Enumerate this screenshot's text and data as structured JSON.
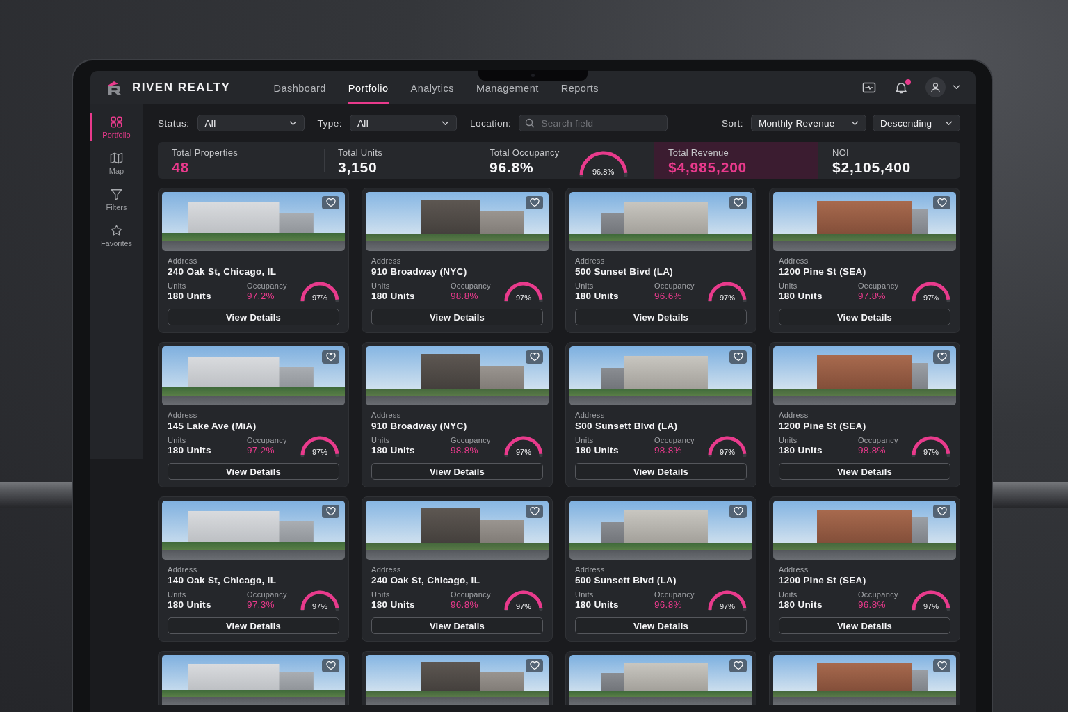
{
  "brand": {
    "name": "RIVEN REALTY"
  },
  "nav": [
    {
      "label": "Dashboard",
      "selected": false
    },
    {
      "label": "Portfolio",
      "selected": true
    },
    {
      "label": "Analytics",
      "selected": false
    },
    {
      "label": "Management",
      "selected": false
    },
    {
      "label": "Reports",
      "selected": false
    }
  ],
  "header_actions": {
    "notifications_unread": true
  },
  "sidebar": [
    {
      "kind": "grid",
      "label": "Portfolio",
      "selected": true
    },
    {
      "kind": "map",
      "label": "Map",
      "selected": false
    },
    {
      "kind": "filter",
      "label": "Filters",
      "selected": false
    },
    {
      "kind": "star",
      "label": "Favorites",
      "selected": false
    }
  ],
  "filters": [
    {
      "kind": "select",
      "label": "Status:",
      "value": "All"
    },
    {
      "kind": "select",
      "label": "Type:",
      "value": "All"
    },
    {
      "kind": "search",
      "label": "Location:",
      "placeholder": "Search field"
    }
  ],
  "sort": {
    "label": "Sort:",
    "field": "Monthly Revenue",
    "order": "Descending"
  },
  "stats": [
    {
      "kind": "number",
      "label": "Total Properties",
      "value": "48",
      "accent": true,
      "highlighted": false
    },
    {
      "kind": "number",
      "label": "Total Units",
      "value": "3,150",
      "accent": false,
      "highlighted": false
    },
    {
      "kind": "gauge",
      "label": "Total Occupancy",
      "value": "96.8%",
      "gauge_reading": "96.8%",
      "level": 0.968,
      "accent": false,
      "highlighted": false
    },
    {
      "kind": "number",
      "label": "Total Revenue",
      "value": "$4,985,200",
      "accent": true,
      "highlighted": true
    },
    {
      "kind": "number",
      "label": "NOI",
      "value": "$2,105,400",
      "accent": false,
      "highlighted": false
    }
  ],
  "properties": [
    {
      "kind": "full",
      "favorite": false,
      "address_label": "Address",
      "address": "240 Oak St, Chicago, IL",
      "units_label": "Units",
      "units": "180 Units",
      "occupancy_label": "Occupancy",
      "occupancy": "97.2%",
      "gauge_reading": "97%",
      "level": 0.97,
      "button": "View Details"
    },
    {
      "kind": "full",
      "favorite": false,
      "address_label": "Address",
      "address": "910 Broadway (NYC)",
      "units_label": "Units",
      "units": "180 Units",
      "occupancy_label": "Occupancy",
      "occupancy": "98.8%",
      "gauge_reading": "97%",
      "level": 0.97,
      "button": "View Details"
    },
    {
      "kind": "full",
      "favorite": false,
      "address_label": "Address",
      "address": "500 Sunset Bivd (LA)",
      "units_label": "Units",
      "units": "180 Units",
      "occupancy_label": "Occupancy",
      "occupancy": "96.6%",
      "gauge_reading": "97%",
      "level": 0.97,
      "button": "View Details"
    },
    {
      "kind": "full",
      "favorite": false,
      "address_label": "Address",
      "address": "1200 Pine St (SEA)",
      "units_label": "Units",
      "units": "180 Units",
      "occupancy_label": "Oecupancy",
      "occupancy": "97.8%",
      "gauge_reading": "97%",
      "level": 0.97,
      "button": "View Details"
    },
    {
      "kind": "full",
      "favorite": false,
      "address_label": "Address",
      "address": "145 Lake Ave (MiA)",
      "units_label": "Units",
      "units": "180 Units",
      "occupancy_label": "Occupancy",
      "occupancy": "97.2%",
      "gauge_reading": "97%",
      "level": 0.97,
      "button": "View Details"
    },
    {
      "kind": "full",
      "favorite": false,
      "address_label": "Address",
      "address": "910 Broadway (NYC)",
      "units_label": "Units",
      "units": "180 Units",
      "occupancy_label": "Gccupancy",
      "occupancy": "98.8%",
      "gauge_reading": "97%",
      "level": 0.97,
      "button": "View Details"
    },
    {
      "kind": "full",
      "favorite": false,
      "address_label": "Address",
      "address": "S00 Sunsett Blvd (LA)",
      "units_label": "Units",
      "units": "180 Units",
      "occupancy_label": "Occupancy",
      "occupancy": "98.8%",
      "gauge_reading": "97%",
      "level": 0.97,
      "button": "View Details"
    },
    {
      "kind": "full",
      "favorite": false,
      "address_label": "Address",
      "address": "1200 Pine St (SEA)",
      "units_label": "Units",
      "units": "180 Units",
      "occupancy_label": "Occupancy",
      "occupancy": "98.8%",
      "gauge_reading": "97%",
      "level": 0.97,
      "button": "View Details"
    },
    {
      "kind": "full",
      "favorite": false,
      "address_label": "Address",
      "address": "140 Oak St, Chicago, IL",
      "units_label": "Units",
      "units": "180 Units",
      "occupancy_label": "Occupancy",
      "occupancy": "97.3%",
      "gauge_reading": "97%",
      "level": 0.97,
      "button": "View Details"
    },
    {
      "kind": "full",
      "favorite": false,
      "address_label": "Address",
      "address": "240 Oak St, Chicago, IL",
      "units_label": "Units",
      "units": "180 Units",
      "occupancy_label": "Occupancy",
      "occupancy": "96.8%",
      "gauge_reading": "97%",
      "level": 0.97,
      "button": "View Details"
    },
    {
      "kind": "full",
      "favorite": false,
      "address_label": "Address",
      "address": "500 Sunsett Bivd (LA)",
      "units_label": "Units",
      "units": "180 Units",
      "occupancy_label": "Occupancy",
      "occupancy": "96.8%",
      "gauge_reading": "97%",
      "level": 0.97,
      "button": "View Details"
    },
    {
      "kind": "full",
      "favorite": false,
      "address_label": "Address",
      "address": "1200 Pine St (SEA)",
      "units_label": "Uoits",
      "units": "180 Units",
      "occupancy_label": "Occupancy",
      "occupancy": "96.8%",
      "gauge_reading": "97%",
      "level": 0.97,
      "button": "View Details"
    },
    {
      "kind": "cut",
      "favorite": false
    },
    {
      "kind": "cut",
      "favorite": false
    },
    {
      "kind": "cut",
      "favorite": false
    },
    {
      "kind": "cut",
      "favorite": false
    }
  ]
}
